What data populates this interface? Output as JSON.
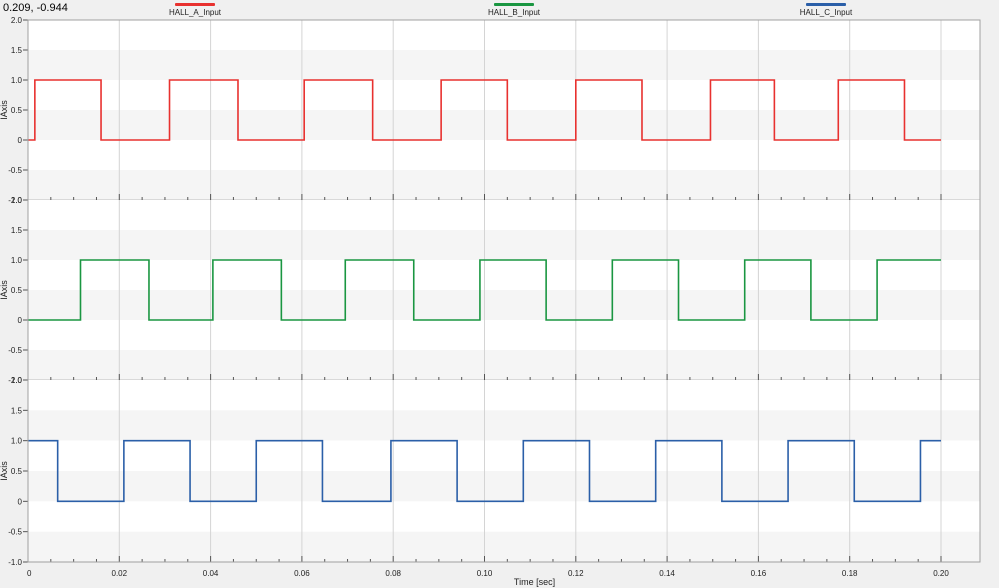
{
  "header": {
    "cursor_readout": "0.209, -0.944"
  },
  "colors": {
    "background": "#f0f0f0",
    "panel_band_light": "#ffffff",
    "panel_band_dark": "#f5f5f5",
    "grid": "#d4d4d4"
  },
  "chart_data": {
    "type": "line",
    "step": true,
    "xlabel": "Time [sec]",
    "xlim": [
      0,
      0.2
    ],
    "x_ticks": [
      "0",
      "0.02",
      "0.04",
      "0.06",
      "0.08",
      "0.10",
      "0.12",
      "0.14",
      "0.16",
      "0.18",
      "0.20"
    ],
    "legend_position": "top",
    "subplots": [
      {
        "ylabel": "IAxis",
        "ylim": [
          -1.0,
          2.0
        ],
        "y_ticks": [
          "2.0",
          "1.5",
          "1.0",
          "0.5",
          "0",
          "-0.5",
          "-1.0"
        ],
        "series": {
          "name": "HALL_A_Input",
          "color": "#e8312f",
          "x": [
            0,
            0.0015,
            0.016,
            0.031,
            0.046,
            0.0605,
            0.0755,
            0.0905,
            0.105,
            0.12,
            0.1345,
            0.1495,
            0.1635,
            0.1775,
            0.192,
            0.2
          ],
          "y": [
            0,
            1,
            0,
            1,
            0,
            1,
            0,
            1,
            0,
            1,
            0,
            1,
            0,
            1,
            0,
            0
          ]
        }
      },
      {
        "ylabel": "IAxis",
        "ylim": [
          -1.0,
          2.0
        ],
        "y_ticks": [
          "2.0",
          "1.5",
          "1.0",
          "0.5",
          "0",
          "-0.5",
          "-1.0"
        ],
        "series": {
          "name": "HALL_B_Input",
          "color": "#1a9641",
          "x": [
            0,
            0.0115,
            0.0265,
            0.0405,
            0.0555,
            0.0695,
            0.0845,
            0.099,
            0.1135,
            0.128,
            0.1425,
            0.157,
            0.1715,
            0.186,
            0.2
          ],
          "y": [
            0,
            1,
            0,
            1,
            0,
            1,
            0,
            1,
            0,
            1,
            0,
            1,
            0,
            1,
            1
          ]
        }
      },
      {
        "ylabel": "IAxis",
        "ylim": [
          -1.0,
          2.0
        ],
        "y_ticks": [
          "2.0",
          "1.5",
          "1.0",
          "0.5",
          "0",
          "-0.5",
          "-1.0"
        ],
        "series": {
          "name": "HALL_C_Input",
          "color": "#2b5fa8",
          "x": [
            0,
            0.0065,
            0.021,
            0.0355,
            0.05,
            0.0645,
            0.0795,
            0.094,
            0.1085,
            0.123,
            0.1375,
            0.152,
            0.1665,
            0.181,
            0.1955,
            0.2
          ],
          "y": [
            1,
            0,
            1,
            0,
            1,
            0,
            1,
            0,
            1,
            0,
            1,
            0,
            1,
            0,
            1,
            1
          ]
        }
      }
    ]
  }
}
